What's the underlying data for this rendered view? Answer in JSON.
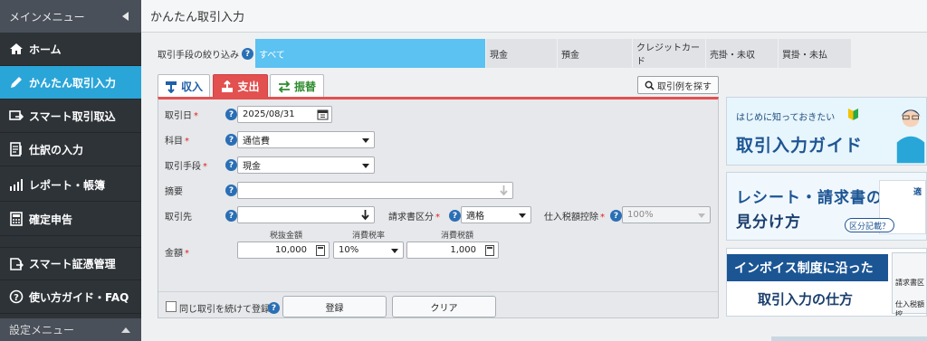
{
  "sidebar": {
    "header": "メインメニュー",
    "items": [
      {
        "label": "ホーム",
        "icon": "home-icon"
      },
      {
        "label": "かんたん取引入力",
        "icon": "pencil-icon"
      },
      {
        "label": "スマート取引取込",
        "icon": "import-icon"
      },
      {
        "label": "仕訳の入力",
        "icon": "journal-icon"
      },
      {
        "label": "レポート・帳簿",
        "icon": "report-icon"
      },
      {
        "label": "確定申告",
        "icon": "calculator-icon"
      },
      {
        "label": "スマート証憑管理",
        "icon": "document-icon"
      },
      {
        "label": "使い方ガイド・FAQ",
        "icon": "question-icon"
      }
    ],
    "footer": "設定メニュー"
  },
  "page": {
    "title": "かんたん取引入力"
  },
  "filter": {
    "label": "取引手段の絞り込み",
    "tabs": [
      "すべて",
      "現金",
      "預金",
      "クレジットカード",
      "売掛・未収",
      "買掛・未払"
    ],
    "selected": "すべて"
  },
  "entry_tabs": {
    "income": "収入",
    "expense": "支出",
    "transfer": "振替",
    "active": "支出"
  },
  "search_example_button": "取引例を探す",
  "form": {
    "date_label": "取引日",
    "date_value": "2025/08/31",
    "subject_label": "科目",
    "subject_value": "通信費",
    "method_label": "取引手段",
    "method_value": "現金",
    "summary_label": "摘要",
    "summary_value": "",
    "partner_label": "取引先",
    "partner_value": "",
    "invoice_label": "請求書区分",
    "invoice_value": "適格",
    "deduction_label": "仕入税額控除",
    "deduction_value": "100%",
    "amount_label": "金額",
    "pretax_label": "税抜金額",
    "pretax_value": "10,000",
    "rate_label": "消費税率",
    "rate_value": "10%",
    "tax_label": "消費税額",
    "tax_value": "1,000",
    "repeat_label": "同じ取引を続けて登録",
    "register_button": "登録",
    "clear_button": "クリア"
  },
  "banners": [
    {
      "small": "はじめに知っておきたい",
      "title": "取引入力ガイド"
    },
    {
      "title_line1": "レシート・請求書の",
      "title_line2": "見分け方",
      "badge": "区分記載？"
    },
    {
      "title_line1": "インボイス制度に沿った",
      "title_line2": "取引入力の仕方",
      "side1": "請求書区",
      "side2": "仕入税額控"
    }
  ],
  "colors": {
    "sidebar_bg": "#2e3338",
    "active_nav": "#2aa5d8",
    "filter_selected": "#5bc2f2",
    "expense_red": "#e25050",
    "help_blue": "#2a6fb5"
  }
}
